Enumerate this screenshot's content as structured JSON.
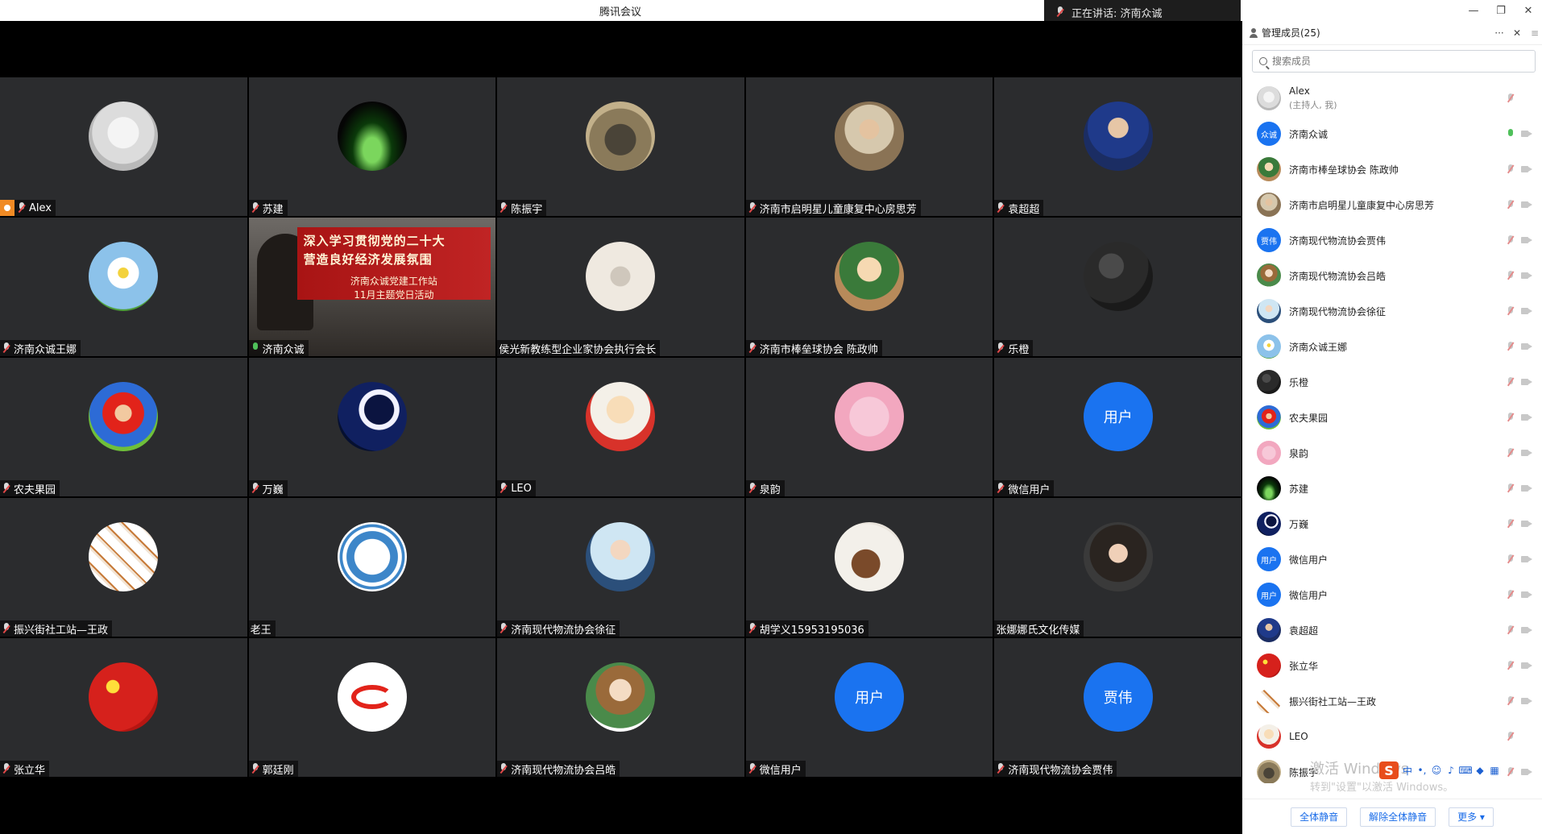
{
  "app": {
    "window_title": "腾讯会议",
    "speaking_text": "正在讲话: 济南众诚"
  },
  "slide": {
    "line1": "深入学习贯彻党的二十大",
    "line2": "营造良好经济发展氛围",
    "line3": "济南众诚党建工作站",
    "line4": "11月主题党日活动"
  },
  "tiles": [
    {
      "name": "Alex",
      "avatar": "a-cat",
      "mic": "off",
      "host": true
    },
    {
      "name": "苏建",
      "avatar": "a-stage",
      "mic": "off"
    },
    {
      "name": "陈振宇",
      "avatar": "a-jeep",
      "mic": "off"
    },
    {
      "name": "济南市启明星儿童康复中心房思芳",
      "avatar": "a-man1",
      "mic": "off"
    },
    {
      "name": "袁超超",
      "avatar": "a-man2",
      "mic": "off"
    },
    {
      "name": "济南众诚王娜",
      "avatar": "a-daisy",
      "mic": "off"
    },
    {
      "name": "济南众诚",
      "avatar": "slide",
      "mic": "on",
      "active": true
    },
    {
      "name": "侯光新教练型企业家协会执行会长",
      "avatar": "a-office",
      "mic": "none"
    },
    {
      "name": "济南市棒垒球协会 陈政帅",
      "avatar": "a-cartoon",
      "mic": "off"
    },
    {
      "name": "乐橙",
      "avatar": "a-lecheng",
      "mic": "off"
    },
    {
      "name": "农夫果园",
      "avatar": "a-mario",
      "mic": "off"
    },
    {
      "name": "万巍",
      "avatar": "a-moon",
      "mic": "off"
    },
    {
      "name": "LEO",
      "avatar": "a-baby",
      "mic": "off"
    },
    {
      "name": "泉韵",
      "avatar": "a-pink",
      "mic": "off"
    },
    {
      "name": "微信用户",
      "avatar": "text",
      "avatar_text": "用户",
      "mic": "off"
    },
    {
      "name": "振兴街社工站—王政",
      "avatar": "a-pattern",
      "mic": "off"
    },
    {
      "name": "老王",
      "avatar": "a-assoc",
      "mic": "none"
    },
    {
      "name": "济南现代物流协会徐征",
      "avatar": "a-couple",
      "mic": "off"
    },
    {
      "name": "胡学义15953195036",
      "avatar": "a-bird",
      "mic": "off"
    },
    {
      "name": "张娜娜氏文化传媒",
      "avatar": "a-girl",
      "mic": "none"
    },
    {
      "name": "张立华",
      "avatar": "a-flag",
      "mic": "off"
    },
    {
      "name": "郭廷刚",
      "avatar": "a-logo",
      "mic": "off"
    },
    {
      "name": "济南现代物流协会吕皓",
      "avatar": "a-doll",
      "mic": "off"
    },
    {
      "name": "微信用户",
      "avatar": "text",
      "avatar_text": "用户",
      "mic": "off"
    },
    {
      "name": "济南现代物流协会贾伟",
      "avatar": "text",
      "avatar_text": "贾伟",
      "mic": "off"
    }
  ],
  "sidebar": {
    "header": "管理成员(25)",
    "more": "···",
    "close": "✕",
    "menu": "≡",
    "search_placeholder": "搜索成员",
    "members": [
      {
        "name": "Alex",
        "sub": "(主持人, 我)",
        "avatar": "a-cat",
        "mic": "off",
        "cam": false
      },
      {
        "name": "济南众诚",
        "avatar": "text",
        "avatar_text": "众诚",
        "mic": "on",
        "cam": true
      },
      {
        "name": "济南市棒垒球协会 陈政帅",
        "avatar": "a-cartoon",
        "mic": "off",
        "cam": true
      },
      {
        "name": "济南市启明星儿童康复中心房思芳",
        "avatar": "a-man1",
        "mic": "off",
        "cam": true
      },
      {
        "name": "济南现代物流协会贾伟",
        "avatar": "text",
        "avatar_text": "贾伟",
        "mic": "off",
        "cam": true
      },
      {
        "name": "济南现代物流协会吕皓",
        "avatar": "a-doll",
        "mic": "off",
        "cam": true
      },
      {
        "name": "济南现代物流协会徐征",
        "avatar": "a-couple",
        "mic": "off",
        "cam": true
      },
      {
        "name": "济南众诚王娜",
        "avatar": "a-daisy",
        "mic": "off",
        "cam": true
      },
      {
        "name": "乐橙",
        "avatar": "a-lecheng",
        "mic": "off",
        "cam": true
      },
      {
        "name": "农夫果园",
        "avatar": "a-mario",
        "mic": "off",
        "cam": true
      },
      {
        "name": "泉韵",
        "avatar": "a-pink",
        "mic": "off",
        "cam": true
      },
      {
        "name": "苏建",
        "avatar": "a-stage",
        "mic": "off",
        "cam": true
      },
      {
        "name": "万巍",
        "avatar": "a-moon",
        "mic": "off",
        "cam": true
      },
      {
        "name": "微信用户",
        "avatar": "text",
        "avatar_text": "用户",
        "mic": "off",
        "cam": true
      },
      {
        "name": "微信用户",
        "avatar": "text",
        "avatar_text": "用户",
        "mic": "off",
        "cam": true
      },
      {
        "name": "袁超超",
        "avatar": "a-man2",
        "mic": "off",
        "cam": true
      },
      {
        "name": "张立华",
        "avatar": "a-flag",
        "mic": "off",
        "cam": true
      },
      {
        "name": "振兴街社工站—王政",
        "avatar": "a-pattern",
        "mic": "off",
        "cam": true
      },
      {
        "name": "LEO",
        "avatar": "a-baby",
        "mic": "off",
        "cam": false
      },
      {
        "name": "陈振宇",
        "avatar": "a-jeep",
        "mic": "off",
        "cam": true
      }
    ],
    "buttons": {
      "mute_all": "全体静音",
      "unmute_all": "解除全体静音",
      "more": "更多 ▾"
    }
  },
  "watermark": {
    "line1": "激活 Windows",
    "line2": "转到\"设置\"以激活 Windows。"
  },
  "ime": {
    "logo": "S",
    "lang": "中"
  },
  "colors": {
    "accent": "#1a6ce8",
    "tile_bg": "#2b2c2e",
    "speaking_border": "#3fa34d"
  }
}
